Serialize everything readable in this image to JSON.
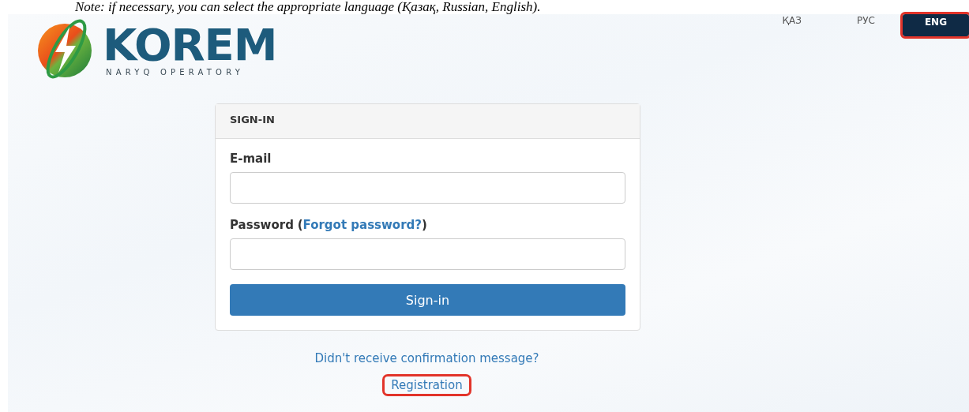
{
  "caption": "Note: if necessary, you can select the appropriate language (Қазақ, Russian, English).",
  "logo": {
    "name": "KOREM",
    "tagline": "NARYQ OPERATORY"
  },
  "languages": [
    {
      "label": "ҚАЗ",
      "selected": false,
      "highlighted": false
    },
    {
      "label": "РУС",
      "selected": false,
      "highlighted": false
    },
    {
      "label": "ENG",
      "selected": true,
      "highlighted": true
    }
  ],
  "panel": {
    "title": "SIGN-IN",
    "email_label": "E-mail",
    "password_label": "Password",
    "paren_open": "(",
    "forgot_link": "Forgot password?",
    "paren_close": ")",
    "submit": "Sign-in"
  },
  "links": [
    {
      "label": "Didn't receive confirmation message?",
      "highlighted": false
    },
    {
      "label": "Registration",
      "highlighted": true
    }
  ]
}
